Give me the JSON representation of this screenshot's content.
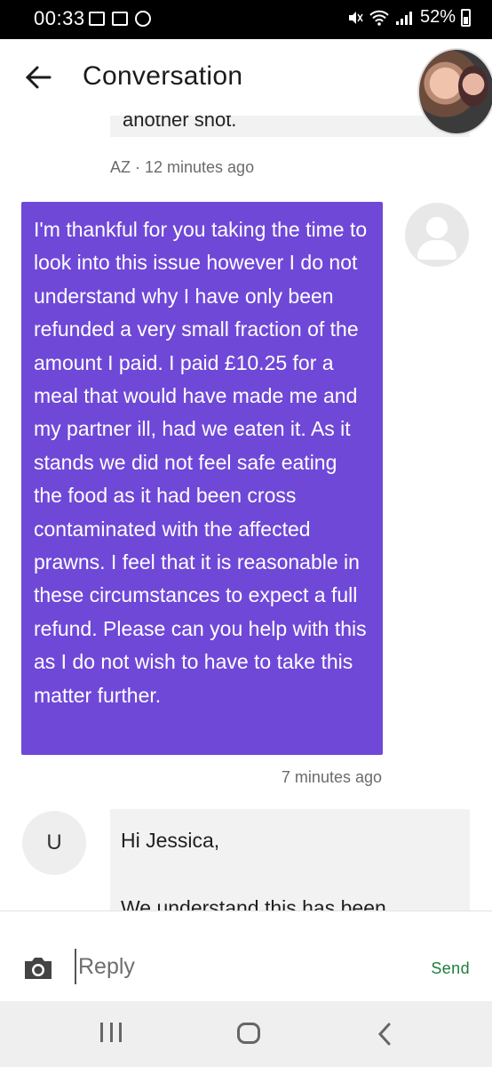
{
  "status_bar": {
    "time": "00:33",
    "battery": "52%"
  },
  "header": {
    "title": "Conversation"
  },
  "messages": {
    "previous_partial_text": "another shot.",
    "previous_meta": "AZ · 12 minutes ago",
    "user_message": "I'm thankful for you taking the time to look into this issue however I do not understand why I have only been refunded a very small fraction of the amount I paid. I paid £10.25 for a meal that would have made me and my partner ill, had we eaten it. As it stands we did not feel safe eating the food as it had been cross contaminated with the affected prawns. I feel that it is reasonable in these circumstances to expect a full refund. Please can you help with this as I do not wish to have to take this matter further.",
    "user_meta": "7 minutes ago",
    "agent_initial": "U",
    "agent_greeting": "Hi Jessica,",
    "agent_partial_text": "We understand this has been"
  },
  "composer": {
    "placeholder": "Reply",
    "send_label": "Send"
  },
  "colors": {
    "user_bubble": "#6f48d8",
    "send": "#1e7d3d"
  }
}
